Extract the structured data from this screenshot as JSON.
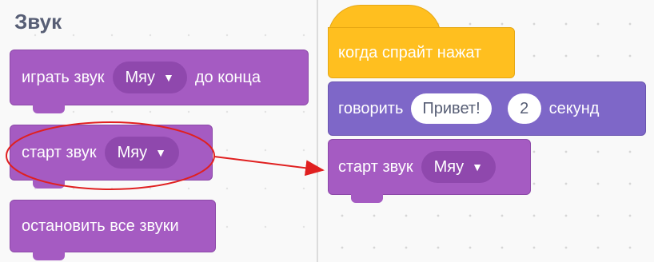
{
  "palette": {
    "category_title": "Звук",
    "blocks": {
      "play_until_done": {
        "label": "играть звук",
        "sound": "Мяу",
        "suffix": "до конца"
      },
      "start_sound": {
        "label": "старт звук",
        "sound": "Мяу"
      },
      "stop_all": {
        "label": "остановить все звуки"
      }
    }
  },
  "workspace": {
    "hat": {
      "label": "когда спрайт нажат"
    },
    "say": {
      "label": "говорить",
      "message": "Привет!",
      "seconds": "2",
      "suffix": "секунд"
    },
    "start_sound": {
      "label": "старт звук",
      "sound": "Мяу"
    }
  },
  "icons": {
    "dropdown": "dropdown-arrow-icon"
  },
  "colors": {
    "sound": "#a55bc2",
    "looks": "#7e67c8",
    "events": "#ffbf1f",
    "annotation": "#e02020"
  }
}
